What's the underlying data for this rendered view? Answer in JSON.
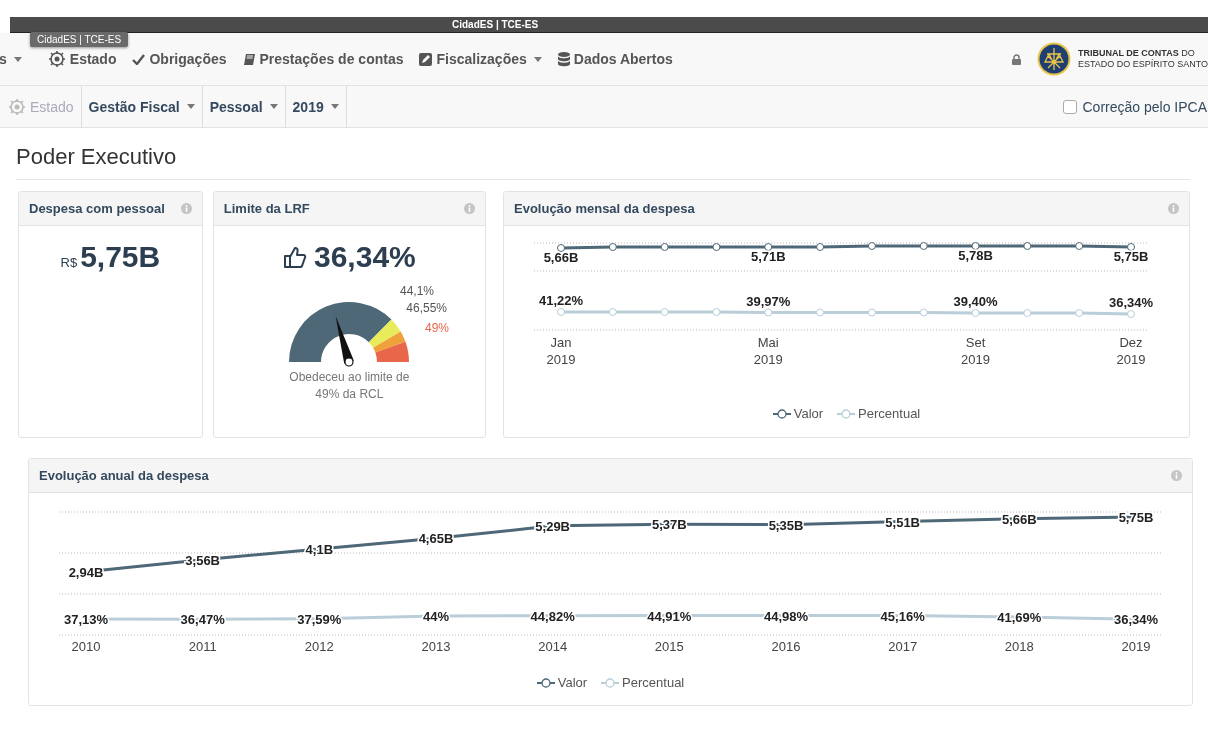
{
  "window": {
    "title": "CidadES | TCE-ES"
  },
  "tooltip": "CidadES | TCE-ES",
  "nav": {
    "items": [
      {
        "label": "s",
        "kind": "text",
        "dropdown": true
      },
      {
        "label": "Estado",
        "kind": "crest",
        "dropdown": false
      },
      {
        "label": "Obrigações",
        "kind": "check",
        "dropdown": false
      },
      {
        "label": "Prestações de contas",
        "kind": "book",
        "dropdown": false
      },
      {
        "label": "Fiscalizações",
        "kind": "edit",
        "dropdown": true
      },
      {
        "label": "Dados Abertos",
        "kind": "database",
        "dropdown": false
      }
    ]
  },
  "brand": {
    "line1": "**TRIBUNAL DE CONTAS** DO",
    "line2": "ESTADO DO ESPÍRITO SANTO"
  },
  "filters": {
    "items": [
      {
        "label": "Estado",
        "kind": "crest",
        "disabled": true,
        "dropdown": false
      },
      {
        "label": "Gestão Fiscal",
        "kind": "text",
        "disabled": false,
        "dropdown": true
      },
      {
        "label": "Pessoal",
        "kind": "text",
        "disabled": false,
        "dropdown": true
      },
      {
        "label": "2019",
        "kind": "text",
        "disabled": false,
        "dropdown": true
      }
    ],
    "ipca": {
      "label": "Correção pelo IPCA",
      "checked": false
    }
  },
  "page_title": "Poder Executivo",
  "cards": {
    "despesa": {
      "title": "Despesa com pessoal",
      "currency": "R$",
      "value": "5,75B"
    },
    "limite": {
      "title": "Limite da LRF",
      "value": "36,34%",
      "gauge": {
        "thresholds": [
          {
            "label": "44,1%",
            "color": "#555555"
          },
          {
            "label": "46,55%",
            "color": "#555555"
          },
          {
            "label": "49%",
            "color": "#e8664a"
          }
        ],
        "caption": "Obedeceu ao limite de 49% da RCL"
      }
    },
    "mensal": {
      "title": "Evolução mensal da despesa",
      "valor_labels": [
        "5,66B",
        "5,71B",
        "5,78B",
        "5,75B"
      ],
      "percent_labels": [
        "41,22%",
        "39,97%",
        "39,40%",
        "36,34%"
      ],
      "x_labels": [
        "Jan 2019",
        "Mai 2019",
        "Set 2019",
        "Dez 2019"
      ],
      "legend": [
        {
          "label": "Valor",
          "color": "#4e6878"
        },
        {
          "label": "Percentual",
          "color": "#b9ced9"
        }
      ]
    },
    "anual": {
      "title": "Evolução anual da despesa",
      "upper_chart": {
        "chart_data": {
          "type": "line",
          "data_labels": true,
          "series": [
            {
              "name": "Valor",
              "color": "#4e6878",
              "values": [
                2.94,
                3.56,
                4.1,
                4.65,
                5.29,
                5.37,
                5.35,
                5.51,
                5.66,
                5.75
              ],
              "value_labels": [
                "2,94B",
                "3,56B",
                "4,1B",
                "4,65B",
                "5,29B",
                "5,37B",
                "5,35B",
                "5,51B",
                "5,66B",
                "5,75B"
              ]
            }
          ]
        }
      },
      "lower_chart": {
        "chart_data": {
          "type": "line",
          "data_labels": true,
          "categories": [
            "2010",
            "2011",
            "2012",
            "2013",
            "2014",
            "2015",
            "2016",
            "2017",
            "2018",
            "2019"
          ],
          "series": [
            {
              "name": "Percentual",
              "color": "#b9ced9",
              "values": [
                37.13,
                36.47,
                37.59,
                44,
                44.82,
                44.91,
                44.98,
                45.16,
                41.69,
                36.34
              ],
              "value_labels": [
                "37,13%",
                "36,47%",
                "37,59%",
                "44%",
                "44,82%",
                "44,91%",
                "44,98%",
                "45,16%",
                "41,69%",
                "36,34%"
              ]
            }
          ]
        }
      }
    }
  }
}
